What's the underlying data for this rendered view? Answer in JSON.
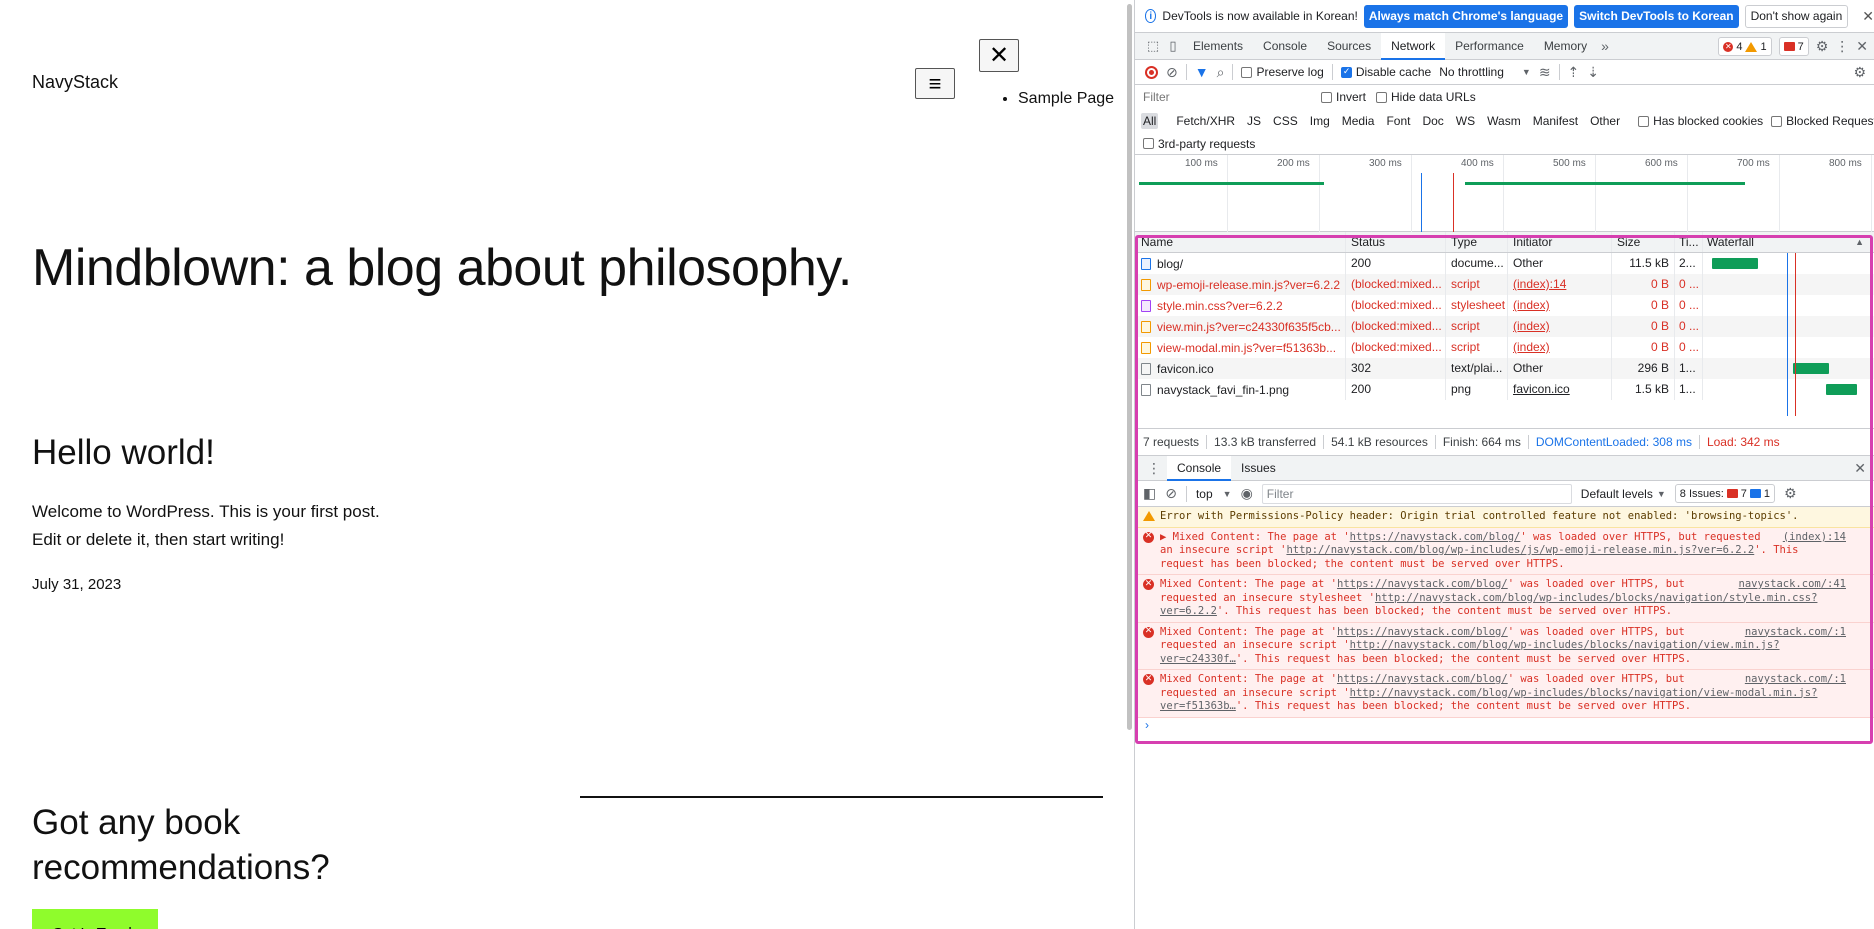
{
  "page": {
    "site_title": "NavyStack",
    "menu_icon": "≡",
    "close_icon": "✕",
    "nav_items": [
      "Sample Page"
    ],
    "blog_heading": "Mindblown: a blog about philosophy.",
    "post_title": "Hello world!",
    "post_body_line1": "Welcome to WordPress. This is your first post.",
    "post_body_line2": "Edit or delete it, then start writing!",
    "post_date": "July 31, 2023",
    "cta_heading_line1": "Got any book",
    "cta_heading_line2": "recommendations?",
    "cta_button": "Get In Touch",
    "cta_button_color": "#8ffc2c"
  },
  "devtools": {
    "infobar": {
      "text": "DevTools is now available in Korean!",
      "btn_match": "Always match Chrome's language",
      "btn_switch": "Switch DevTools to Korean",
      "btn_dont": "Don't show again"
    },
    "tabs": [
      "Elements",
      "Console",
      "Sources",
      "Network",
      "Performance",
      "Memory"
    ],
    "active_tab": "Network",
    "counts": {
      "errors": "4",
      "warnings": "1",
      "issues": "7"
    },
    "toolbar": {
      "preserve_log": "Preserve log",
      "disable_cache": "Disable cache",
      "throttling": "No throttling"
    },
    "filter": {
      "placeholder": "Filter",
      "invert": "Invert",
      "hide_data_urls": "Hide data URLs"
    },
    "types": [
      "All",
      "Fetch/XHR",
      "JS",
      "CSS",
      "Img",
      "Media",
      "Font",
      "Doc",
      "WS",
      "Wasm",
      "Manifest",
      "Other"
    ],
    "has_blocked_cookies": "Has blocked cookies",
    "blocked_requests": "Blocked Requests",
    "third_party": "3rd-party requests",
    "overview_ticks": [
      "100 ms",
      "200 ms",
      "300 ms",
      "400 ms",
      "500 ms",
      "600 ms",
      "700 ms",
      "800 ms"
    ],
    "columns": {
      "name": "Name",
      "status": "Status",
      "type": "Type",
      "initiator": "Initiator",
      "size": "Size",
      "time": "Ti...",
      "waterfall": "Waterfall"
    },
    "requests": [
      {
        "name": "blog/",
        "status": "200",
        "type": "docume...",
        "initiator": "Other",
        "size": "11.5 kB",
        "time": "2...",
        "blocked": false,
        "kind": "doc",
        "wf_start": 0.03,
        "wf_len": 0.31
      },
      {
        "name": "wp-emoji-release.min.js?ver=6.2.2",
        "status": "(blocked:mixed...",
        "type": "script",
        "initiator": "(index):14",
        "size": "0 B",
        "time": "0 ...",
        "blocked": true,
        "kind": "js",
        "wf_start": 0,
        "wf_len": 0
      },
      {
        "name": "style.min.css?ver=6.2.2",
        "status": "(blocked:mixed...",
        "type": "stylesheet",
        "initiator": "(index)",
        "size": "0 B",
        "time": "0 ...",
        "blocked": true,
        "kind": "css",
        "wf_start": 0,
        "wf_len": 0
      },
      {
        "name": "view.min.js?ver=c24330f635f5cb...",
        "status": "(blocked:mixed...",
        "type": "script",
        "initiator": "(index)",
        "size": "0 B",
        "time": "0 ...",
        "blocked": true,
        "kind": "js",
        "wf_start": 0,
        "wf_len": 0
      },
      {
        "name": "view-modal.min.js?ver=f51363b...",
        "status": "(blocked:mixed...",
        "type": "script",
        "initiator": "(index)",
        "size": "0 B",
        "time": "0 ...",
        "blocked": true,
        "kind": "js",
        "wf_start": 0,
        "wf_len": 0
      },
      {
        "name": "favicon.ico",
        "status": "302",
        "type": "text/plai...",
        "initiator": "Other",
        "size": "296 B",
        "time": "1...",
        "blocked": false,
        "kind": "file",
        "wf_start": 0.57,
        "wf_len": 0.24
      },
      {
        "name": "navystack_favi_fin-1.png",
        "status": "200",
        "type": "png",
        "initiator": "favicon.ico",
        "size": "1.5 kB",
        "time": "1...",
        "blocked": false,
        "kind": "file",
        "wf_start": 0.79,
        "wf_len": 0.21
      }
    ],
    "summary": {
      "requests": "7 requests",
      "transferred": "13.3 kB transferred",
      "resources": "54.1 kB resources",
      "finish": "Finish: 664 ms",
      "dcl": "DOMContentLoaded: 308 ms",
      "load": "Load: 342 ms"
    },
    "drawer_tabs": [
      "Console",
      "Issues"
    ],
    "console_bar": {
      "context": "top",
      "filter_placeholder": "Filter",
      "levels": "Default levels",
      "issues_label": "8 Issues:",
      "issues_err": "7",
      "issues_info": "1"
    },
    "messages": [
      {
        "level": "warn",
        "src": "",
        "text": "Error with Permissions-Policy header: Origin trial controlled feature not enabled: 'browsing-topics'."
      },
      {
        "level": "err",
        "src": "(index):14",
        "prefix": "▶ Mixed Content: The page at '",
        "page_url": "https://navystack.com/blog/",
        "mid": "' was loaded over HTTPS, but requested an insecure script '",
        "res_url": "http://navystack.com/blog/wp-includes/js/wp-emoji-release.min.js?ver=6.2.2",
        "suffix": "'. This request has been blocked; the content must be served over HTTPS."
      },
      {
        "level": "err",
        "src": "navystack.com/:41",
        "prefix": "Mixed Content: The page at '",
        "page_url": "https://navystack.com/blog/",
        "mid": "' was loaded over HTTPS, but requested an insecure stylesheet '",
        "res_url": "http://navystack.com/blog/wp-includes/blocks/navigation/style.min.css?ver=6.2.2",
        "suffix": "'. This request has been blocked; the content must be served over HTTPS."
      },
      {
        "level": "err",
        "src": "navystack.com/:1",
        "prefix": "Mixed Content: The page at '",
        "page_url": "https://navystack.com/blog/",
        "mid": "' was loaded over HTTPS, but requested an insecure script '",
        "res_url": "http://navystack.com/blog/wp-includes/blocks/navigation/view.min.js?ver=c24330f…",
        "suffix": "'. This request has been blocked; the content must be served over HTTPS."
      },
      {
        "level": "err",
        "src": "navystack.com/:1",
        "prefix": "Mixed Content: The page at '",
        "page_url": "https://navystack.com/blog/",
        "mid": "' was loaded over HTTPS, but requested an insecure script '",
        "res_url": "http://navystack.com/blog/wp-includes/blocks/navigation/view-modal.min.js?ver=f51363b…",
        "suffix": "'. This request has been blocked; the content must be served over HTTPS."
      }
    ],
    "prompt": "›"
  }
}
